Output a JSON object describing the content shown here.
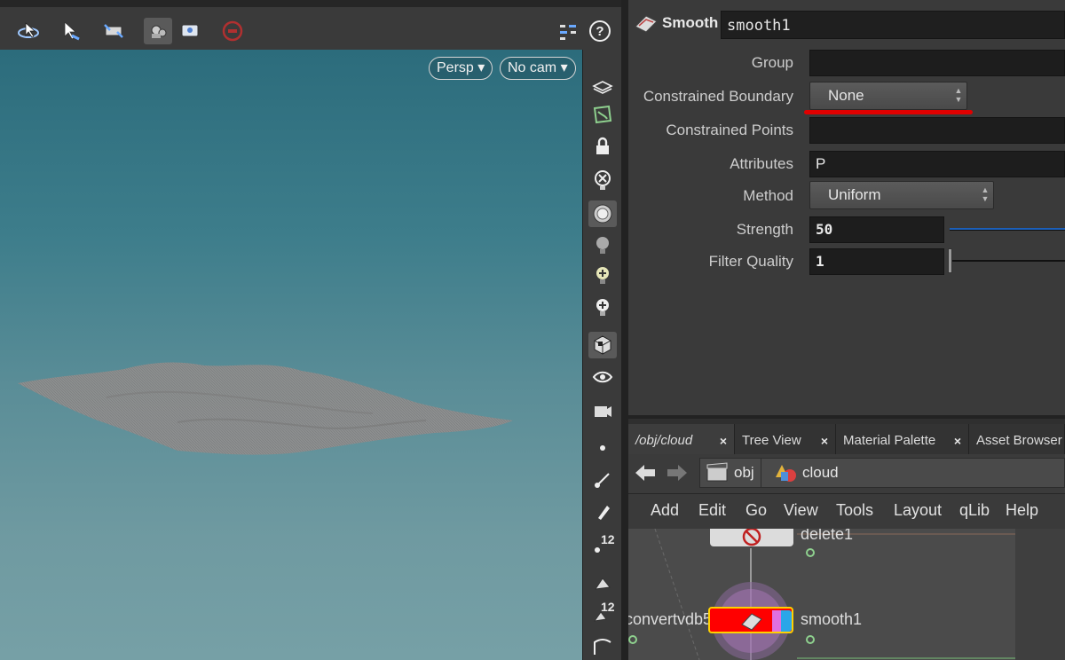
{
  "viewport": {
    "view_label": "Persp",
    "camera_label": "No cam"
  },
  "toolbar_icons": [
    "orbit-icon",
    "select-icon",
    "view-transform-icon",
    "camera-icon",
    "display-icon",
    "no-entry-icon",
    "settings-icon",
    "help-icon"
  ],
  "strip": {
    "numbers": [
      "12",
      "12"
    ]
  },
  "params": {
    "node_type": "Smooth",
    "node_name": "smooth1",
    "group_label": "Group",
    "group_value": "",
    "constrained_boundary_label": "Constrained Boundary",
    "constrained_boundary_value": "None",
    "constrained_points_label": "Constrained Points",
    "constrained_points_value": "",
    "attributes_label": "Attributes",
    "attributes_value": "P",
    "method_label": "Method",
    "method_value": "Uniform",
    "strength_label": "Strength",
    "strength_value": "50",
    "filter_quality_label": "Filter Quality",
    "filter_quality_value": "1",
    "accent_color": "#e00000"
  },
  "network": {
    "tabs": [
      {
        "label": "/obj/cloud"
      },
      {
        "label": "Tree View"
      },
      {
        "label": "Material Palette"
      },
      {
        "label": "Asset Browser"
      }
    ],
    "path": [
      "obj",
      "cloud"
    ],
    "menu": [
      "Add",
      "Edit",
      "Go",
      "View",
      "Tools",
      "Layout",
      "qLib",
      "Help"
    ],
    "nodes": {
      "top": "delete1",
      "left": "convertvdb5",
      "current": "smooth1"
    },
    "current_node_color": "#ff0000"
  }
}
